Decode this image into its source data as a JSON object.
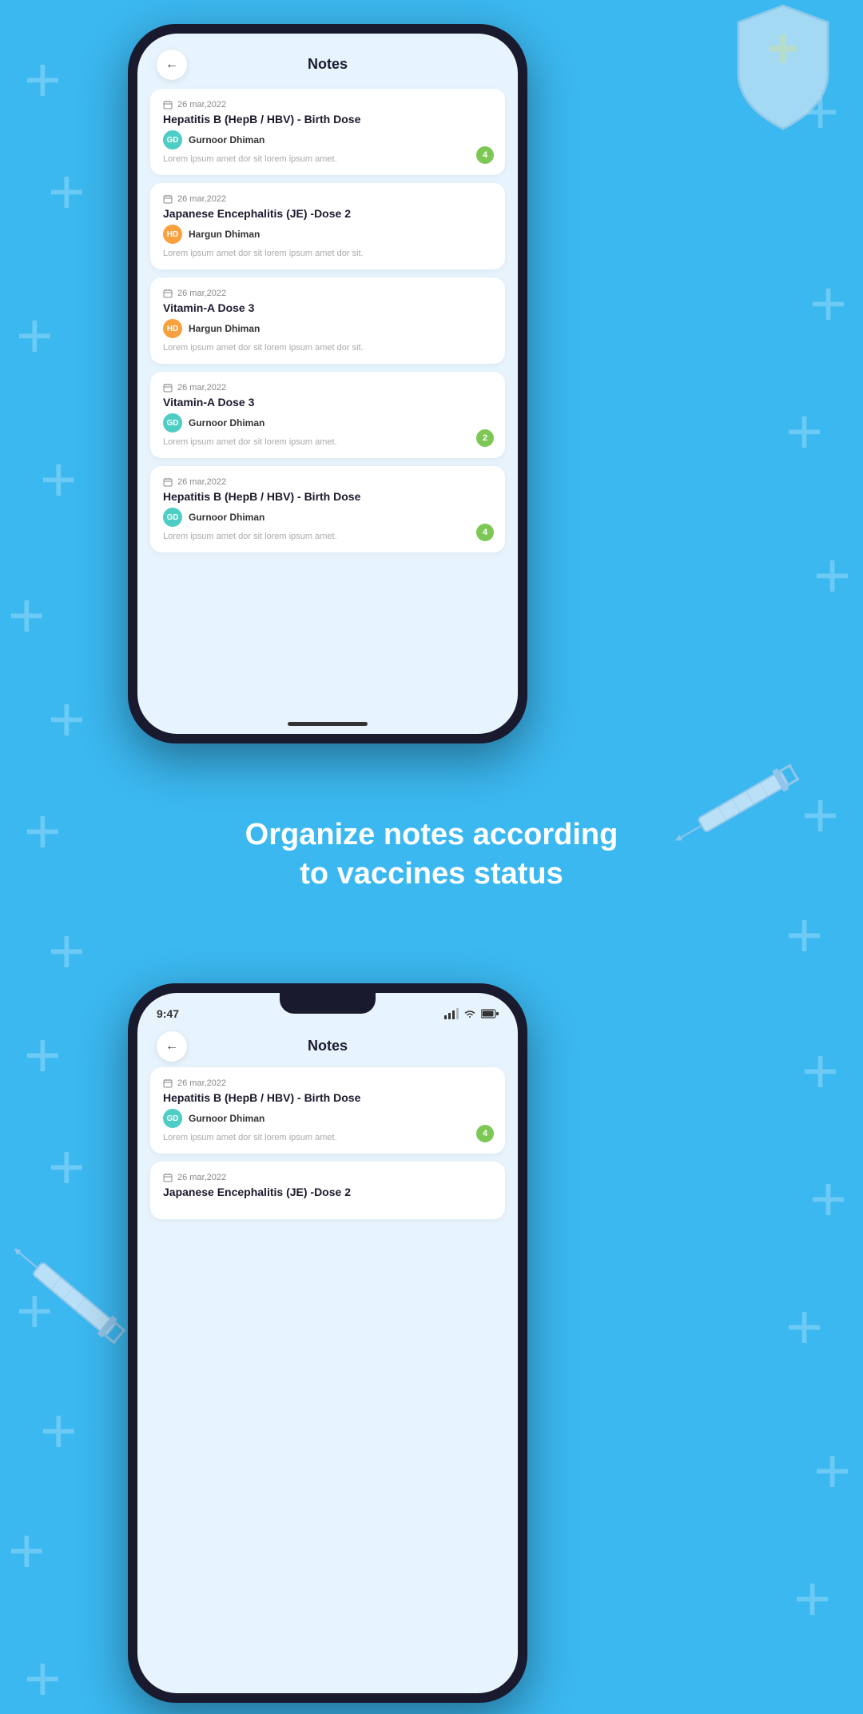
{
  "background_color": "#3bb8f0",
  "phone1": {
    "title": "Notes",
    "notes": [
      {
        "date": "26 mar,2022",
        "vaccine": "Hepatitis B (HepB / HBV) - Birth Dose",
        "person": "Gurnoor Dhiman",
        "avatar_color": "teal",
        "avatar_initials": "GD",
        "note_text": "Lorem ipsum amet dor sit lorem ipsum amet.",
        "badge": "4"
      },
      {
        "date": "26 mar,2022",
        "vaccine": "Japanese Encephalitis (JE) -Dose 2",
        "person": "Hargun Dhiman",
        "avatar_color": "orange",
        "avatar_initials": "HD",
        "note_text": "Lorem ipsum amet dor sit lorem ipsum amet dor sit.",
        "badge": null
      },
      {
        "date": "26 mar,2022",
        "vaccine": "Vitamin-A Dose 3",
        "person": "Hargun Dhiman",
        "avatar_color": "orange",
        "avatar_initials": "HD",
        "note_text": "Lorem ipsum amet dor sit lorem ipsum amet dor sit.",
        "badge": null
      },
      {
        "date": "26 mar,2022",
        "vaccine": "Vitamin-A Dose 3",
        "person": "Gurnoor Dhiman",
        "avatar_color": "teal",
        "avatar_initials": "GD",
        "note_text": "Lorem ipsum amet dor sit lorem ipsum amet.",
        "badge": "2"
      },
      {
        "date": "26 mar,2022",
        "vaccine": "Hepatitis B (HepB / HBV) - Birth Dose",
        "person": "Gurnoor Dhiman",
        "avatar_color": "teal",
        "avatar_initials": "GD",
        "note_text": "Lorem ipsum amet dor sit lorem ipsum amet.",
        "badge": "4"
      }
    ]
  },
  "tagline": {
    "line1": "Organize notes according",
    "line2": "to vaccines status"
  },
  "phone2": {
    "status_time": "9:47",
    "title": "Notes",
    "notes": [
      {
        "date": "26 mar,2022",
        "vaccine": "Hepatitis B (HepB / HBV) - Birth Dose",
        "person": "Gurnoor Dhiman",
        "avatar_color": "teal",
        "avatar_initials": "GD",
        "note_text": "Lorem ipsum amet dor sit lorem ipsum amet.",
        "badge": "4"
      },
      {
        "date": "26 mar,2022",
        "vaccine": "Japanese Encephalitis (JE) -Dose 2",
        "person": null,
        "note_text": null,
        "badge": null
      }
    ]
  },
  "back_arrow": "←",
  "calendar_icon": "📅"
}
